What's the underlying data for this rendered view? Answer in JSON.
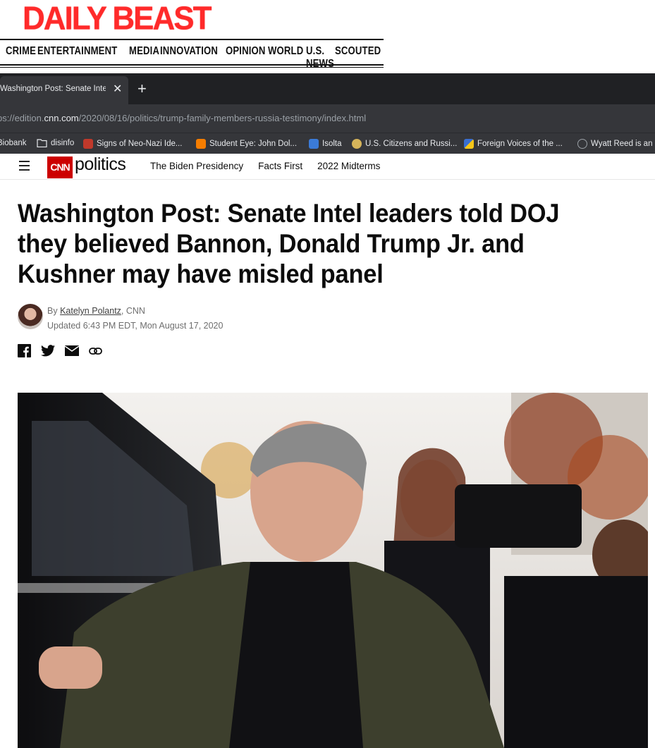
{
  "daily_beast": {
    "logo": "DAILY BEAST",
    "nav": [
      "CRIME",
      "ENTERTAINMENT",
      "MEDIA",
      "INNOVATION",
      "OPINION",
      "WORLD",
      "U.S. NEWS",
      "SCOUTED"
    ]
  },
  "browser": {
    "tab_title": "Washington Post: Senate Intel l",
    "url_prefix": "ps://edition.",
    "url_domain": "cnn.com",
    "url_path": "/2020/08/16/politics/trump-family-members-russia-testimony/index.html",
    "bookmarks": [
      {
        "label": "Biobank",
        "icon": "page-icon",
        "color": "#5f6368"
      },
      {
        "label": "disinfo",
        "icon": "folder-icon",
        "color": "#e8eaed"
      },
      {
        "label": "Signs of Neo-Nazi Ide...",
        "icon": "favicon-red",
        "color": "#c0392b"
      },
      {
        "label": "Student Eye: John Dol...",
        "icon": "blogger-icon",
        "color": "#f57d00"
      },
      {
        "label": "Isolta",
        "icon": "favicon-blue",
        "color": "#3b7bd8"
      },
      {
        "label": "U.S. Citizens and Russi...",
        "icon": "favicon-round",
        "color": "#d6b45a"
      },
      {
        "label": "Foreign Voices of the ...",
        "icon": "favicon-flag",
        "color": "#3a6fd1"
      },
      {
        "label": "Wyatt Reed is an",
        "icon": "favicon-w",
        "color": "#9aa0a6"
      }
    ]
  },
  "cnn": {
    "logo": "CNN",
    "section": "politics",
    "nav": [
      "The Biden Presidency",
      "Facts First",
      "2022 Midterms"
    ]
  },
  "article": {
    "headline": "Washington Post: Senate Intel leaders told DOJ they believed Bannon, Donald Trump Jr. and Kushner may have misled panel",
    "by_prefix": "By ",
    "author": "Katelyn Polantz",
    "by_suffix": ", CNN",
    "updated": "Updated 6:43 PM EDT, Mon August 17, 2020"
  },
  "colors": {
    "cnn_red": "#cc0000",
    "daily_beast_red": "#ff2a2a",
    "chrome_dark": "#202124"
  }
}
